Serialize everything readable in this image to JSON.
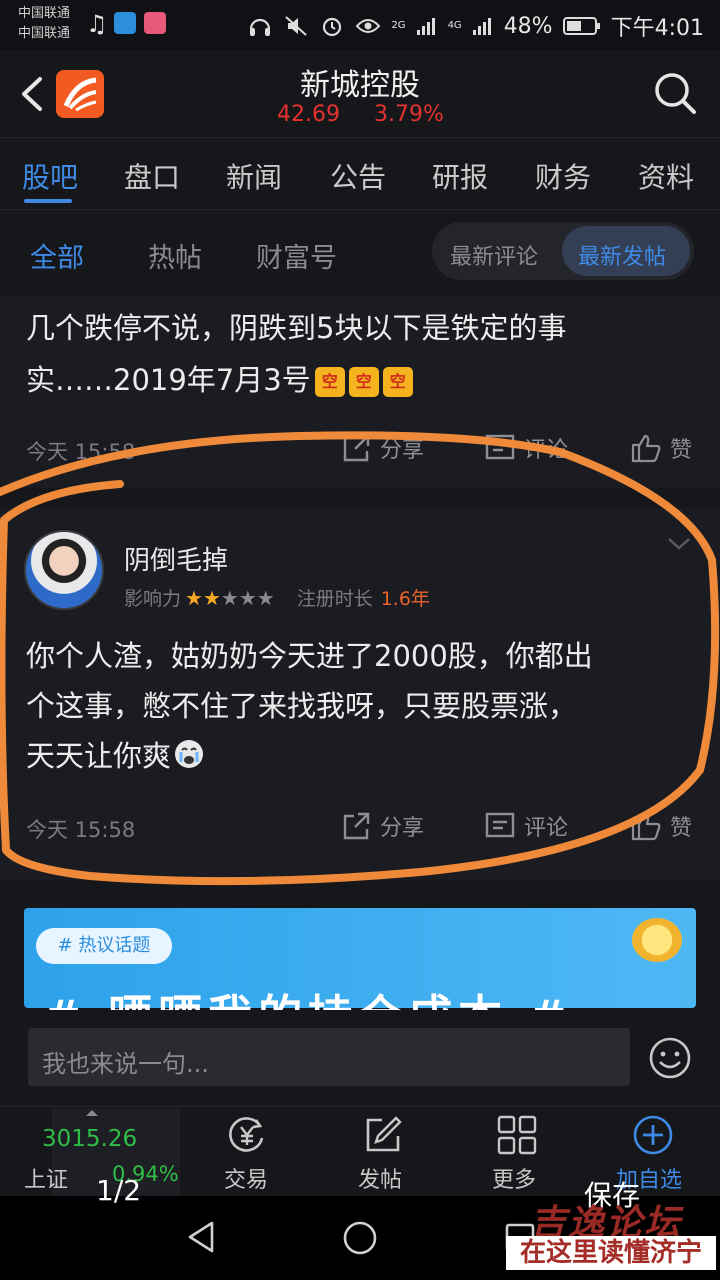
{
  "status_bar": {
    "carrier_1": "中国联通",
    "carrier_2": "中国联通",
    "signal_2g": "2G",
    "signal_4g": "4G",
    "battery": "48%",
    "time": "下午4:01"
  },
  "header": {
    "title": "新城控股",
    "price": "42.69",
    "change": "3.79%",
    "accent_color": "#3e8ae6",
    "price_color": "#e4322f"
  },
  "tabs": [
    {
      "label": "股吧",
      "active": true
    },
    {
      "label": "盘口"
    },
    {
      "label": "新闻"
    },
    {
      "label": "公告"
    },
    {
      "label": "研报"
    },
    {
      "label": "财务"
    },
    {
      "label": "资料"
    }
  ],
  "subtabs": {
    "all": "全部",
    "hot": "热帖",
    "wealth": "财富号",
    "sort_latest_comment": "最新评论",
    "sort_latest_post": "最新发帖"
  },
  "post1": {
    "text_line1": "几个跌停不说，阴跌到5块以下是铁定的事",
    "text_line2": "实……2019年7月3号",
    "emoji": "空",
    "time": "今天 15:58",
    "share": "分享",
    "comment": "评论",
    "like": "赞"
  },
  "post2": {
    "username": "阴倒毛掉",
    "influence_label": "影响力",
    "stars_filled": 2,
    "stars_total": 5,
    "reg_label": "注册时长",
    "reg_value": "1.6年",
    "text_line1": "你个人渣，姑奶奶今天进了2000股，你都出",
    "text_line2": "个这事，憋不住了来找我呀，只要股票涨，",
    "text_line3": "天天让你爽",
    "time": "今天 15:58",
    "share": "分享",
    "comment": "评论",
    "like": "赞"
  },
  "banner": {
    "tag": "# 热议话题",
    "headline": "# 晒晒我的持仓成本 #"
  },
  "comment_input": {
    "placeholder": "我也来说一句..."
  },
  "bottom_nav": {
    "index_value": "3015.26",
    "index_name": "上证",
    "index_change": "0.94%",
    "trade": "交易",
    "post": "发帖",
    "more": "更多",
    "add_watch": "加自选"
  },
  "viewer_overlay": {
    "page": "1/2",
    "save": "保存"
  },
  "watermark": {
    "line1": "吉逸论坛",
    "line2": "在这里读懂济宁"
  }
}
